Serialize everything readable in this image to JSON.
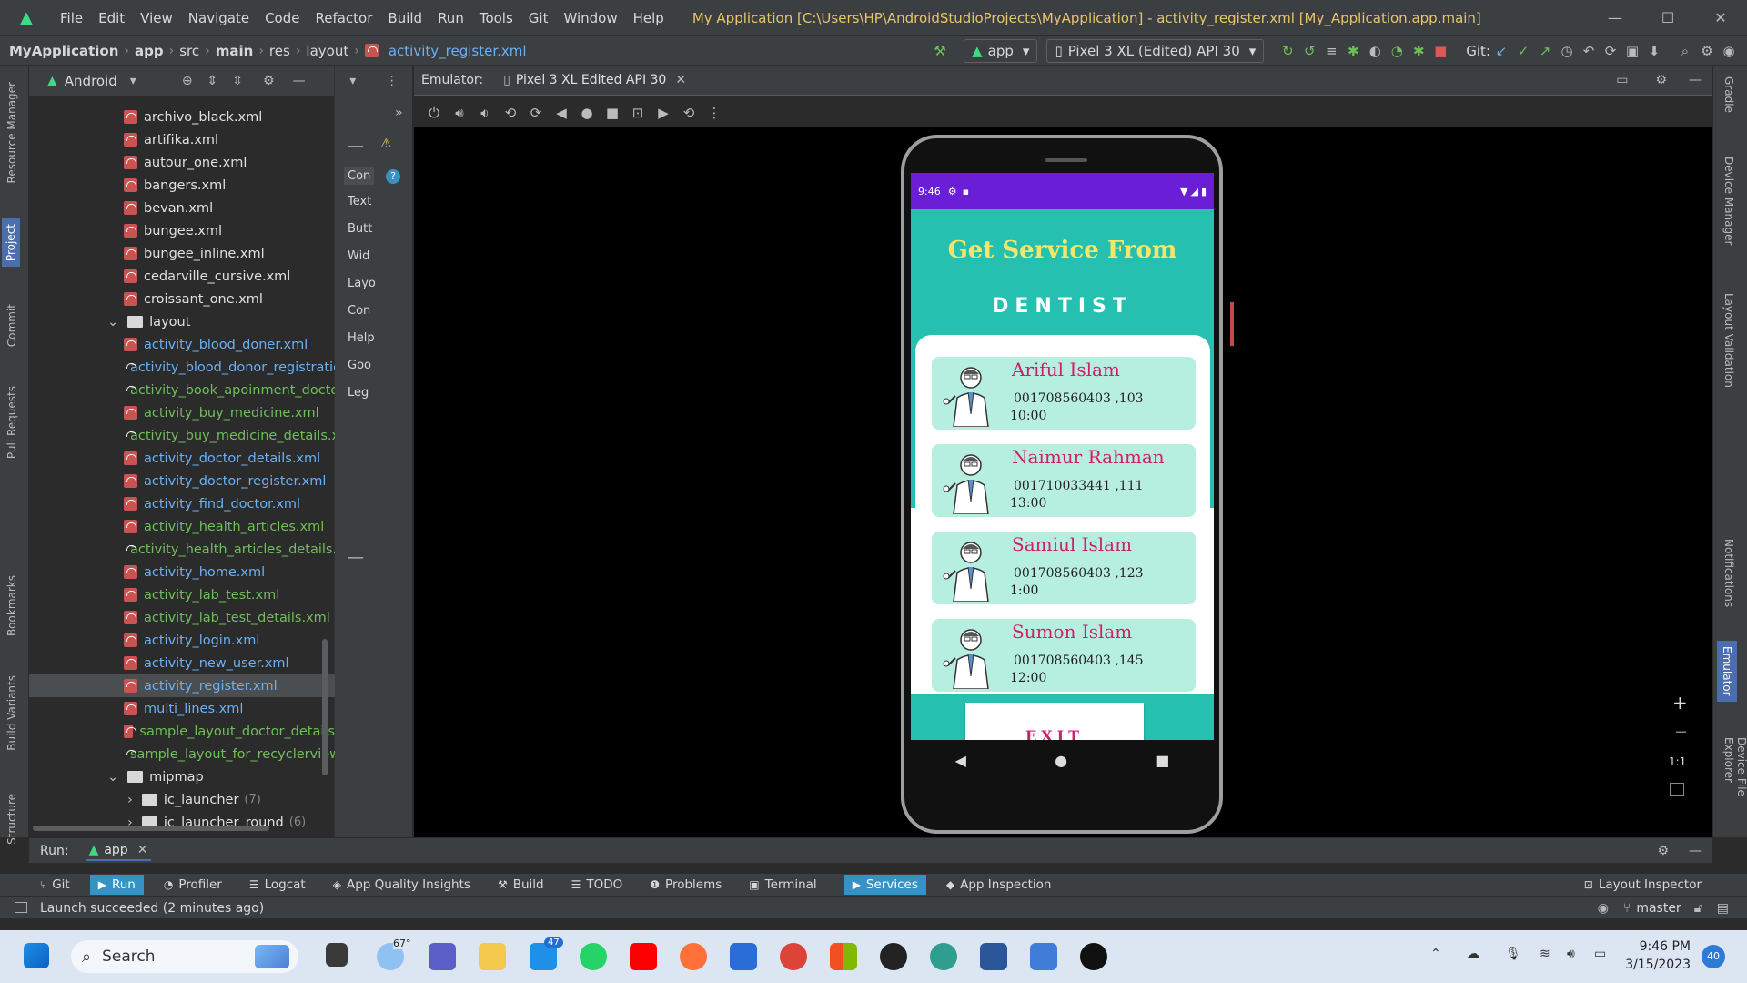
{
  "window": {
    "menu": [
      "File",
      "Edit",
      "View",
      "Navigate",
      "Code",
      "Refactor",
      "Build",
      "Run",
      "Tools",
      "Git",
      "Window",
      "Help"
    ],
    "title": "My Application [C:\\Users\\HP\\AndroidStudioProjects\\MyApplication] - activity_register.xml [My_Application.app.main]",
    "controls": [
      "—",
      "☐",
      "✕"
    ]
  },
  "navbar": {
    "crumbs": [
      "MyApplication",
      "app",
      "src",
      "main",
      "res",
      "layout"
    ],
    "file": "activity_register.xml",
    "run_config": "app",
    "device": "Pixel 3 XL (Edited) API 30",
    "git_label": "Git:"
  },
  "left_stripe": [
    "Resource Manager",
    "Project",
    "Commit",
    "Pull Requests",
    "Bookmarks",
    "Build Variants",
    "Structure"
  ],
  "project": {
    "view_mode": "Android",
    "items": [
      {
        "label": "archivo_black.xml",
        "type": "file",
        "color": "white"
      },
      {
        "label": "artifika.xml",
        "type": "file",
        "color": "white"
      },
      {
        "label": "autour_one.xml",
        "type": "file",
        "color": "white"
      },
      {
        "label": "bangers.xml",
        "type": "file",
        "color": "white"
      },
      {
        "label": "bevan.xml",
        "type": "file",
        "color": "white"
      },
      {
        "label": "bungee.xml",
        "type": "file",
        "color": "white"
      },
      {
        "label": "bungee_inline.xml",
        "type": "file",
        "color": "white"
      },
      {
        "label": "cedarville_cursive.xml",
        "type": "file",
        "color": "white"
      },
      {
        "label": "croissant_one.xml",
        "type": "file",
        "color": "white"
      },
      {
        "label": "layout",
        "type": "folder",
        "color": "white"
      },
      {
        "label": "activity_blood_doner.xml",
        "type": "file",
        "color": "blue"
      },
      {
        "label": "activity_blood_donor_registratio",
        "type": "file",
        "color": "blue"
      },
      {
        "label": "activity_book_apoinment_docto",
        "type": "file",
        "color": "green"
      },
      {
        "label": "activity_buy_medicine.xml",
        "type": "file",
        "color": "green"
      },
      {
        "label": "activity_buy_medicine_details.xr",
        "type": "file",
        "color": "green"
      },
      {
        "label": "activity_doctor_details.xml",
        "type": "file",
        "color": "blue"
      },
      {
        "label": "activity_doctor_register.xml",
        "type": "file",
        "color": "blue"
      },
      {
        "label": "activity_find_doctor.xml",
        "type": "file",
        "color": "blue"
      },
      {
        "label": "activity_health_articles.xml",
        "type": "file",
        "color": "green"
      },
      {
        "label": "activity_health_articles_details.x",
        "type": "file",
        "color": "green"
      },
      {
        "label": "activity_home.xml",
        "type": "file",
        "color": "blue"
      },
      {
        "label": "activity_lab_test.xml",
        "type": "file",
        "color": "green"
      },
      {
        "label": "activity_lab_test_details.xml",
        "type": "file",
        "color": "green"
      },
      {
        "label": "activity_login.xml",
        "type": "file",
        "color": "blue"
      },
      {
        "label": "activity_new_user.xml",
        "type": "file",
        "color": "blue"
      },
      {
        "label": "activity_register.xml",
        "type": "file",
        "color": "blue"
      },
      {
        "label": "multi_lines.xml",
        "type": "file",
        "color": "blue"
      },
      {
        "label": "sample_layout_doctor_details",
        "type": "file",
        "color": "green"
      },
      {
        "label": "sample_layout_for_recyclerview",
        "type": "file",
        "color": "green"
      },
      {
        "label": "mipmap",
        "type": "folder",
        "color": "white"
      },
      {
        "label": "ic_launcher",
        "type": "folder",
        "color": "white",
        "count": "(7)"
      },
      {
        "label": "ic_launcher_round",
        "type": "folder",
        "color": "white",
        "count": "(6)"
      }
    ]
  },
  "palette": [
    "Con",
    "Text",
    "Butt",
    "Wid",
    "Layo",
    "Con",
    "Help",
    "Goo",
    "Leg"
  ],
  "emulator": {
    "label": "Emulator:",
    "tab": "Pixel 3 XL Edited API 30"
  },
  "phone": {
    "time": "9:46",
    "app_title": "Get Service From",
    "app_subtitle": "DENTIST",
    "doctors": [
      {
        "name": "Ariful Islam",
        "phone": "001708560403 ,103",
        "time": "10:00"
      },
      {
        "name": "Naimur Rahman",
        "phone": "001710033441 ,111",
        "time": "13:00"
      },
      {
        "name": "Samiul Islam",
        "phone": "001708560403 ,123",
        "time": "1:00"
      },
      {
        "name": "Sumon Islam",
        "phone": "001708560403 ,145",
        "time": "12:00"
      }
    ],
    "exit": "EXIT"
  },
  "right_stripe": [
    "Gradle",
    "Device Manager",
    "Layout Validation",
    "Notifications",
    "Emulator",
    "Device File Explorer"
  ],
  "zoom": {
    "plus": "+",
    "minus": "−",
    "ratio": "1:1"
  },
  "run_bar": {
    "label": "Run:",
    "tab": "app"
  },
  "tool_tabs": [
    "Git",
    "Run",
    "Profiler",
    "Logcat",
    "App Quality Insights",
    "Build",
    "TODO",
    "Problems",
    "Terminal",
    "Services",
    "App Inspection"
  ],
  "layout_inspector": "Layout Inspector",
  "status": {
    "message": "Launch succeeded (2 minutes ago)",
    "branch": "master"
  },
  "taskbar": {
    "search": "Search",
    "weather": "67°",
    "mail_badge": "47",
    "time": "9:46 PM",
    "date": "3/15/2023",
    "notif": "40"
  },
  "colors": {
    "accent": "#a020c0",
    "teal": "#26c0b0",
    "card": "#b6efe0",
    "name": "#d01f6a",
    "title": "#f5e56b",
    "statusbar": "#6a1fd6"
  }
}
